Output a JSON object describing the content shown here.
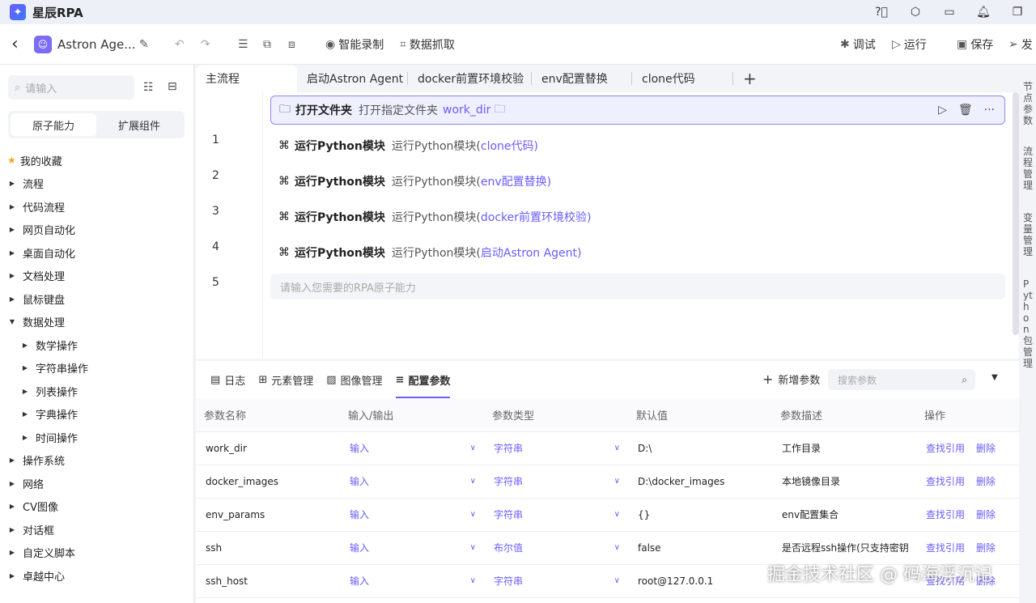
{
  "app": {
    "name": "星辰RPA",
    "logo_glyph": "✦"
  },
  "titlebar_icons": [
    "help-icon",
    "settings-icon",
    "monitor-icon",
    "bell-icon",
    "restore-icon"
  ],
  "toolbar": {
    "back": "‹",
    "project_name": "Astron Age...",
    "smart_record": "智能录制",
    "data_capture": "数据抓取",
    "debug": "调试",
    "run": "运行",
    "save": "保存",
    "publish": "发"
  },
  "sidebar": {
    "search_placeholder": "请输入",
    "tabs": [
      "原子能力",
      "扩展组件"
    ],
    "favorites": "我的收藏",
    "items": [
      "流程",
      "代码流程",
      "网页自动化",
      "桌面自动化",
      "文档处理",
      "鼠标键盘",
      "数据处理"
    ],
    "sub_items": [
      "数学操作",
      "字符串操作",
      "列表操作",
      "字典操作",
      "时间操作"
    ],
    "items_after": [
      "操作系统",
      "网络",
      "CV图像",
      "对话框",
      "自定义脚本",
      "卓越中心"
    ]
  },
  "editor": {
    "tabs": [
      "主流程",
      "启动Astron Agent",
      "docker前置环境校验",
      "env配置替换",
      "clone代码"
    ],
    "steps": [
      {
        "name": "打开文件夹",
        "desc": "打开指定文件夹",
        "param": "work_dir"
      },
      {
        "name": "运行Python模块",
        "desc": "运行Python模块(",
        "param": "clone代码",
        "tail": ")"
      },
      {
        "name": "运行Python模块",
        "desc": "运行Python模块(",
        "param": "env配置替换",
        "tail": ")"
      },
      {
        "name": "运行Python模块",
        "desc": "运行Python模块(",
        "param": "docker前置环境校验",
        "tail": ")"
      },
      {
        "name": "运行Python模块",
        "desc": "运行Python模块(",
        "param": "启动Astron Agent",
        "tail": ")"
      }
    ],
    "line_numbers": [
      "1",
      "2",
      "3",
      "4",
      "5"
    ],
    "add_placeholder": "请输入您需要的RPA原子能力"
  },
  "right_rail": [
    "节点参数",
    "流程管理",
    "变量管理",
    "Python包管理"
  ],
  "bottom": {
    "tabs": [
      "日志",
      "元素管理",
      "图像管理",
      "配置参数"
    ],
    "add_param": "新增参数",
    "search_placeholder": "搜索参数",
    "columns": [
      "参数名称",
      "输入/输出",
      "参数类型",
      "默认值",
      "参数描述",
      "操作"
    ],
    "rows": [
      {
        "name": "work_dir",
        "io": "输入",
        "type": "字符串",
        "default": "D:\\",
        "desc": "工作目录"
      },
      {
        "name": "docker_images",
        "io": "输入",
        "type": "字符串",
        "default": "D:\\docker_images",
        "desc": "本地镜像目录"
      },
      {
        "name": "env_params",
        "io": "输入",
        "type": "字符串",
        "default": "{}",
        "desc": "env配置集合"
      },
      {
        "name": "ssh",
        "io": "输入",
        "type": "布尔值",
        "default": "false",
        "desc": "是否远程ssh操作(只支持密钥"
      },
      {
        "name": "ssh_host",
        "io": "输入",
        "type": "字符串",
        "default": "root@127.0.0.1",
        "desc": ""
      }
    ],
    "op_find": "查找引用",
    "op_delete": "删除"
  },
  "watermark": "掘金技术社区 @ 码海浮沉记",
  "colors": {
    "accent": "#6a5cff",
    "selected_bg": "#eef0ff"
  }
}
